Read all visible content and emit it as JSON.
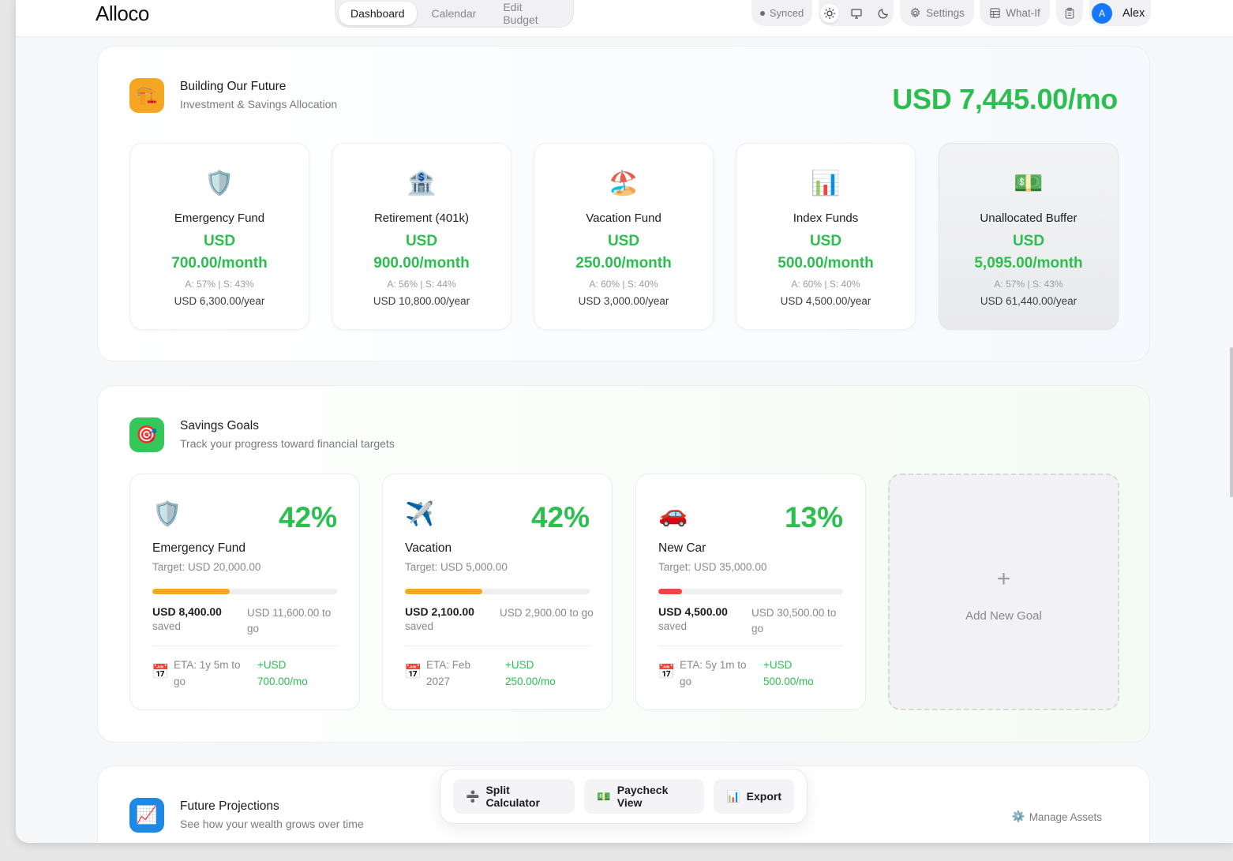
{
  "app": {
    "name": "Alloco"
  },
  "nav": {
    "tabs": [
      {
        "label": "Dashboard",
        "active": true
      },
      {
        "label": "Calendar"
      },
      {
        "label": "Edit Budget"
      }
    ]
  },
  "header": {
    "sync_status": "Synced",
    "theme_icons": [
      "sun-icon",
      "monitor-icon",
      "moon-icon"
    ],
    "settings_label": "Settings",
    "whatif_label": "What-If",
    "user": {
      "initial": "A",
      "name": "Alex"
    }
  },
  "allocation": {
    "title": "Building Our Future",
    "subtitle": "Investment & Savings Allocation",
    "total": "USD 7,445.00/mo",
    "cards": [
      {
        "icon": "🛡️",
        "name": "Emergency Fund",
        "currency": "USD",
        "amount": "700.00/month",
        "split": "A: 57% | S: 43%",
        "yearly": "USD 6,300.00/year"
      },
      {
        "icon": "🏦",
        "name": "Retirement (401k)",
        "currency": "USD",
        "amount": "900.00/month",
        "split": "A: 56% | S: 44%",
        "yearly": "USD 10,800.00/year"
      },
      {
        "icon": "🏖️",
        "name": "Vacation Fund",
        "currency": "USD",
        "amount": "250.00/month",
        "split": "A: 60% | S: 40%",
        "yearly": "USD 3,000.00/year"
      },
      {
        "icon": "📊",
        "name": "Index Funds",
        "currency": "USD",
        "amount": "500.00/month",
        "split": "A: 60% | S: 40%",
        "yearly": "USD 4,500.00/year"
      },
      {
        "icon": "💵",
        "name": "Unallocated Buffer",
        "currency": "USD",
        "amount": "5,095.00/month",
        "split": "A: 57% | S: 43%",
        "yearly": "USD 61,440.00/year"
      }
    ]
  },
  "goals": {
    "title": "Savings Goals",
    "subtitle": "Track your progress toward financial targets",
    "items": [
      {
        "icon": "🛡️",
        "percent": "42%",
        "progress": 0.42,
        "bar_color": "#f5a623",
        "name": "Emergency Fund",
        "target": "Target: USD 20,000.00",
        "saved_value": "USD 8,400.00",
        "saved_label": "saved",
        "to_go": "USD 11,600.00 to go",
        "eta": "ETA: 1y 5m to go",
        "contribution": "+USD 700.00/mo"
      },
      {
        "icon": "✈️",
        "percent": "42%",
        "progress": 0.42,
        "bar_color": "#f5a623",
        "name": "Vacation",
        "target": "Target: USD 5,000.00",
        "saved_value": "USD 2,100.00",
        "saved_label": "saved",
        "to_go": "USD 2,900.00 to go",
        "eta": "ETA: Feb 2027",
        "contribution": "+USD 250.00/mo"
      },
      {
        "icon": "🚗",
        "percent": "13%",
        "progress": 0.13,
        "bar_color": "#ef4444",
        "name": "New Car",
        "target": "Target: USD 35,000.00",
        "saved_value": "USD 4,500.00",
        "saved_label": "saved",
        "to_go": "USD 30,500.00 to go",
        "eta": "ETA: 5y 1m to go",
        "contribution": "+USD 500.00/mo"
      }
    ],
    "add_label": "Add New Goal"
  },
  "projections": {
    "title": "Future Projections",
    "subtitle": "See how your wealth grows over time",
    "manage_label": "Manage Assets"
  },
  "dock": {
    "split_label": "Split Calculator",
    "paycheck_label": "Paycheck View",
    "export_label": "Export"
  },
  "colors": {
    "accent_green": "#2dbe50",
    "avatar_blue": "#1677ff",
    "alloc_icon_bg": "#f5a623",
    "goals_icon_bg": "#34c759",
    "proj_icon_bg": "#1e88e5"
  }
}
